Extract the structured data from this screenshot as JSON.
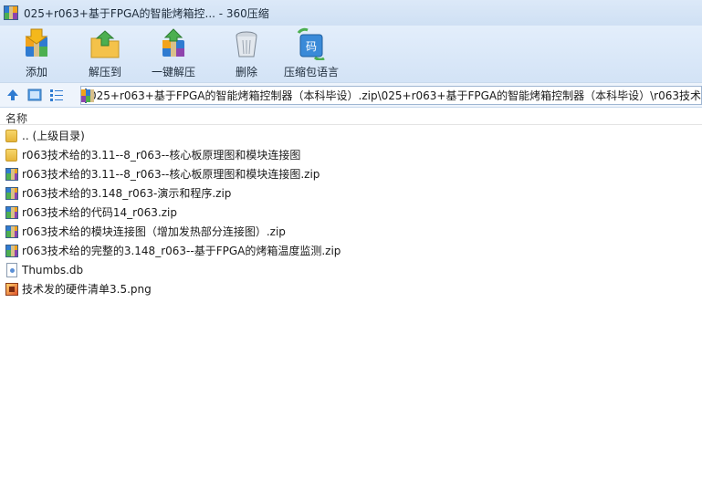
{
  "window": {
    "title": "025+r063+基于FPGA的智能烤箱控... - 360压缩"
  },
  "toolbar": [
    {
      "label": "添加",
      "icon": "add-archive-icon"
    },
    {
      "label": "解压到",
      "icon": "extract-to-icon"
    },
    {
      "label": "一键解压",
      "icon": "one-click-extract-icon"
    },
    {
      "label": "删除",
      "icon": "delete-icon"
    },
    {
      "label": "压缩包语言",
      "icon": "archive-language-icon"
    }
  ],
  "address": {
    "path": "025+r063+基于FPGA的智能烤箱控制器（本科毕设）.zip\\025+r063+基于FPGA的智能烤箱控制器（本科毕设）\\r063技术"
  },
  "list": {
    "column_name": "名称",
    "items": [
      {
        "name": ".. (上级目录)",
        "type": "folder"
      },
      {
        "name": "r063技术给的3.11--8_r063--核心板原理图和模块连接图",
        "type": "folder"
      },
      {
        "name": "r063技术给的3.11--8_r063--核心板原理图和模块连接图.zip",
        "type": "zip"
      },
      {
        "name": "r063技术给的3.148_r063-演示和程序.zip",
        "type": "zip"
      },
      {
        "name": "r063技术给的代码14_r063.zip",
        "type": "zip"
      },
      {
        "name": "r063技术给的模块连接图（增加发热部分连接图）.zip",
        "type": "zip"
      },
      {
        "name": "r063技术给的完整的3.148_r063--基于FPGA的烤箱温度监测.zip",
        "type": "zip"
      },
      {
        "name": "Thumbs.db",
        "type": "db"
      },
      {
        "name": "技术发的硬件清单3.5.png",
        "type": "png"
      }
    ]
  }
}
